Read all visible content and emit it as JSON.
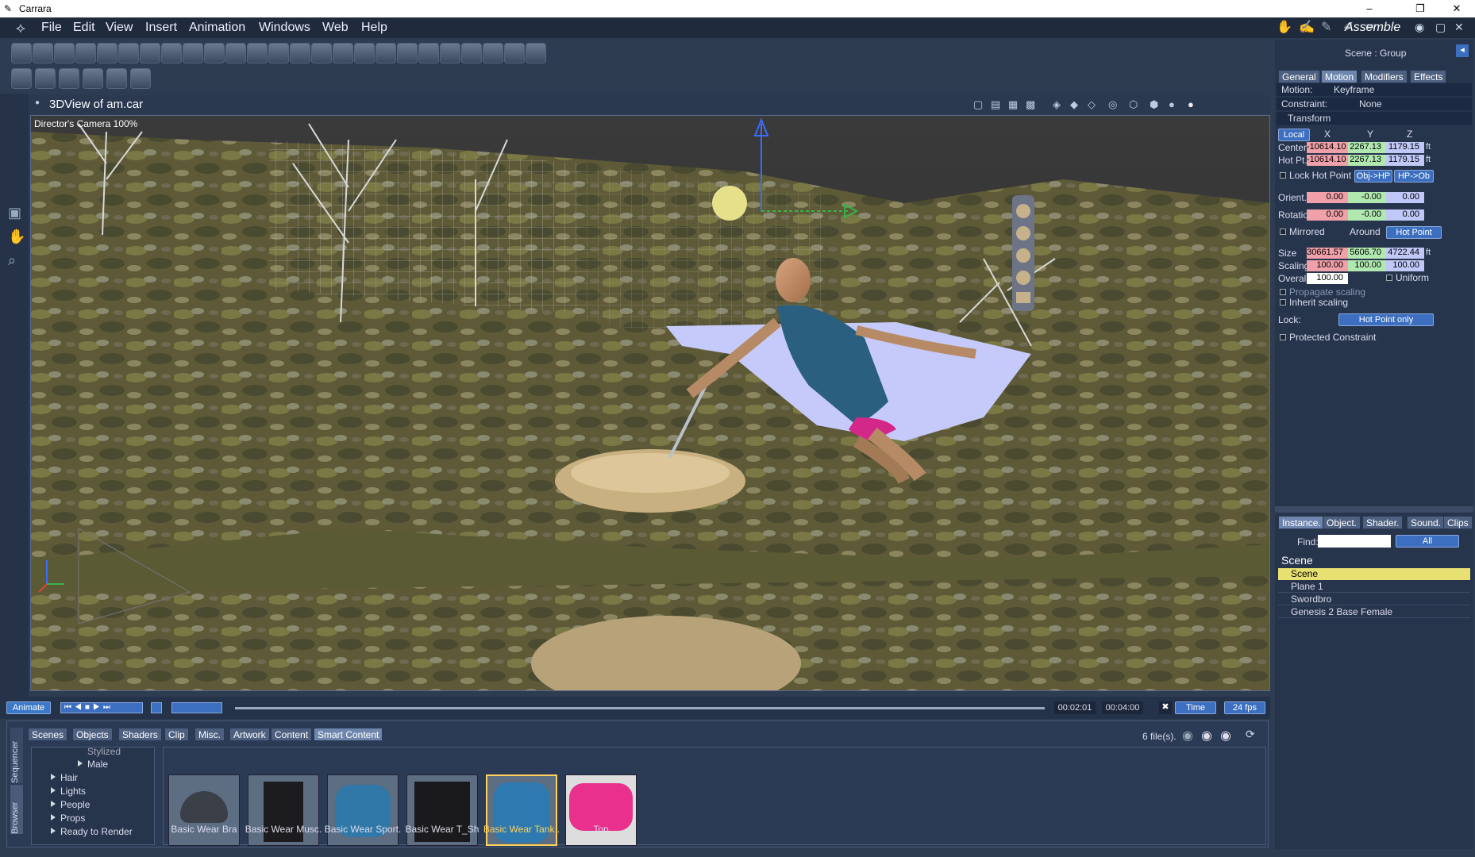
{
  "window": {
    "title": "Carrara",
    "minimize": "–",
    "restore": "❐",
    "close": "✕"
  },
  "menu": [
    "File",
    "Edit",
    "View",
    "Insert",
    "Animation",
    "Windows",
    "Web",
    "Help"
  ],
  "room": {
    "label": "Assemble"
  },
  "view": {
    "title": "3DView of am.car",
    "camera": "Director's Camera 100%"
  },
  "timeline": {
    "mode": "Animate",
    "current": "00:02:01",
    "end": "00:04:00",
    "time": "Time",
    "fps": "24 fps"
  },
  "browser": {
    "tabs": [
      "Scenes",
      "Objects",
      "Shaders",
      "Clip",
      "Misc.",
      "Artwork",
      "Content",
      "Smart Content"
    ],
    "file_count": "6 file(s).",
    "side_tabs": [
      "Sequencer",
      "Browser"
    ],
    "tree": [
      "Stylized",
      "Male",
      "Hair",
      "Lights",
      "People",
      "Props",
      "Ready to Render"
    ],
    "items": [
      {
        "label": "Basic Wear Bra",
        "color": "#3a3f48"
      },
      {
        "label": "Basic Wear Musc.",
        "color": "#1c1c1e"
      },
      {
        "label": "Basic Wear Sport.",
        "color": "#2f78a8"
      },
      {
        "label": "Basic Wear T_Sh",
        "color": "#1a1a1c"
      },
      {
        "label": "Basic Wear Tank .",
        "color": "#2e7ab0"
      },
      {
        "label": "Top",
        "color": "#e8308c"
      }
    ]
  },
  "props": {
    "header": "Scene : Group",
    "tabs": [
      "General",
      "Motion",
      "Modifiers",
      "Effects"
    ],
    "motion_label": "Motion:",
    "motion_value": "Keyframe",
    "constraint_label": "Constraint:",
    "constraint_value": "None",
    "transform": "Transform",
    "space": "Local",
    "axes": [
      "X",
      "Y",
      "Z"
    ],
    "center_label": "Center",
    "center": [
      "-10614.10",
      "2267.13",
      "1179.15"
    ],
    "hotpt_label": "Hot Pt.",
    "hotpt": [
      "-10614.10",
      "2267.13",
      "1179.15"
    ],
    "unit": "ft",
    "lock_hot_point": "Lock Hot Point",
    "obj_hp": "Obj->HP",
    "hp_obj": "HP->Ob",
    "orient_label": "Orient.",
    "orient": [
      "0.00",
      "-0.00",
      "0.00"
    ],
    "rotation_label": "Rotatio",
    "rotation": [
      "0.00",
      "-0.00",
      "0.00"
    ],
    "mirrored": "Mirrored",
    "around": "Around",
    "around_value": "Hot Point",
    "size_label": "Size",
    "size": [
      "30661.57",
      "5606.70",
      "4722.44"
    ],
    "scaling_label": "Scaling",
    "scaling": [
      "100.00",
      "100.00",
      "100.00"
    ],
    "overall_label": "Overal",
    "overall": "100.00",
    "uniform": "Uniform",
    "propagate": "Propagate scaling",
    "inherit": "Inherit scaling",
    "lock_label": "Lock:",
    "lock_value": "Hot Point only",
    "protected": "Protected Constraint"
  },
  "instance": {
    "tabs": [
      "Instance.",
      "Object.",
      "Shader.",
      "Sound.",
      "Clips"
    ],
    "find_label": "Find:",
    "find_value": "",
    "filter": "All",
    "root": "Scene",
    "items": [
      "Scene",
      "Plane 1",
      "Swordbro",
      "Genesis 2 Base Female"
    ]
  }
}
